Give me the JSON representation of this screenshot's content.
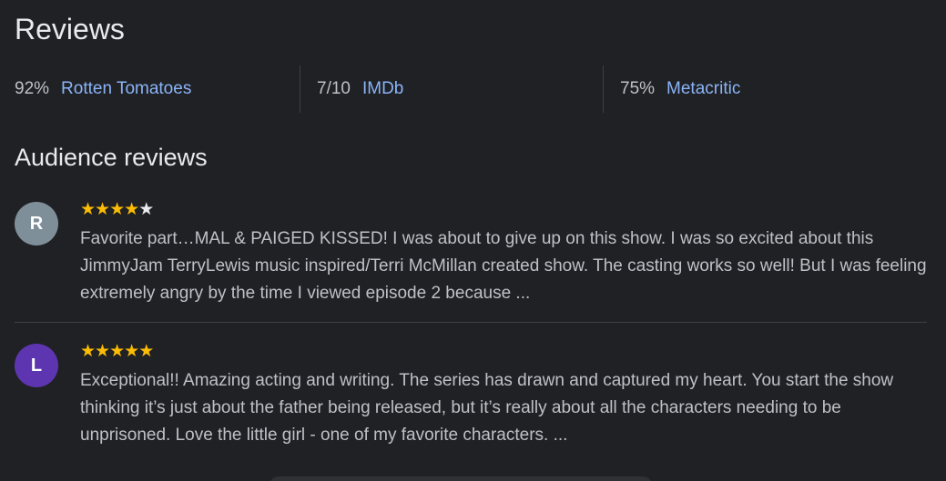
{
  "reviews_section": {
    "title": "Reviews",
    "scores": [
      {
        "value": "92%",
        "source": "Rotten Tomatoes"
      },
      {
        "value": "7/10",
        "source": "IMDb"
      },
      {
        "value": "75%",
        "source": "Metacritic"
      }
    ]
  },
  "audience": {
    "title": "Audience reviews",
    "reviews": [
      {
        "avatar_letter": "R",
        "avatar_color": "#7f8f9a",
        "rating": 4,
        "max_rating": 5,
        "text": "Favorite part…MAL & PAIGED KISSED! I was about to give up on this show. I was so excited about this JimmyJam TerryLewis music inspired/Terri McMillan created show. The casting works so well! But I was feeling extremely angry by the time I viewed episode 2 because ..."
      },
      {
        "avatar_letter": "L",
        "avatar_color": "#5e35b1",
        "rating": 5,
        "max_rating": 5,
        "text": "Exceptional!! Amazing acting and writing. The series has drawn and captured my heart. You start the show thinking it’s just about the father being released, but it’s really about all the characters needing to be unprisoned. Love the little girl - one of my favorite characters. ..."
      }
    ]
  },
  "colors": {
    "background": "#202124",
    "link": "#8ab4f8",
    "star": "#fbbc04"
  }
}
